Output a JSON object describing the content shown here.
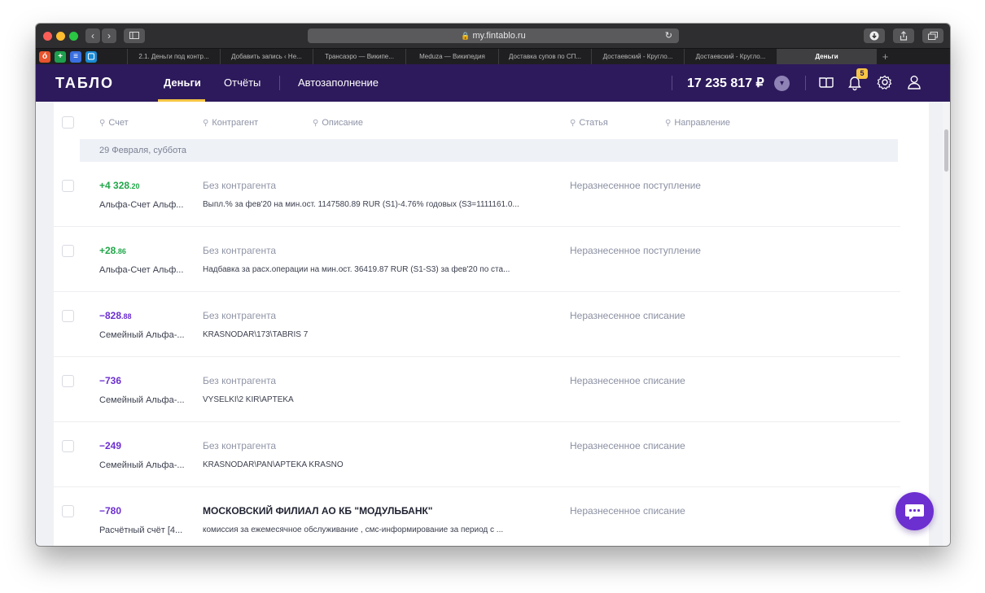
{
  "browser": {
    "url": "my.fintablo.ru",
    "tabs": [
      {
        "label": "2.1. Деньги под контр..."
      },
      {
        "label": "Добавить запись ‹ Не..."
      },
      {
        "label": "Трансаэро — Википе..."
      },
      {
        "label": "Meduza — Википедия"
      },
      {
        "label": "Доставка супов по СП..."
      },
      {
        "label": "Достаевский - Кругло..."
      },
      {
        "label": "Достаевский - Кругло..."
      },
      {
        "label": "Деньги"
      }
    ]
  },
  "header": {
    "logo": "ТАБЛО",
    "nav": [
      {
        "label": "Деньги"
      },
      {
        "label": "Отчёты"
      },
      {
        "label": "Автозаполнение"
      }
    ],
    "balance": "17 235 817 ₽",
    "notifications_count": "5"
  },
  "columns": {
    "account": "Счет",
    "counterparty": "Контрагент",
    "description": "Описание",
    "category": "Статья",
    "direction": "Направление"
  },
  "date_group": "29 Февраля, суббота",
  "transactions": [
    {
      "amount_main": "+4 328",
      "amount_cents": ".20",
      "account": "Альфа-Счет Альф...",
      "counterparty": "Без контрагента",
      "description": "Выпл.% за фев'20 на мин.ост. 1147580.89 RUR (S1)-4.76% годовых (S3=1111161.0...",
      "category": "Неразнесенное поступление"
    },
    {
      "amount_main": "+28",
      "amount_cents": ".86",
      "account": "Альфа-Счет Альф...",
      "counterparty": "Без контрагента",
      "description": "Надбавка за расх.операции на мин.ост. 36419.87 RUR (S1-S3) за фев'20 по ста...",
      "category": "Неразнесенное поступление"
    },
    {
      "amount_main": "−828",
      "amount_cents": ".88",
      "account": "Семейный Альфа-...",
      "counterparty": "Без контрагента",
      "description": "KRASNODAR\\173\\TABRIS 7",
      "category": "Неразнесенное списание"
    },
    {
      "amount_main": "−736",
      "amount_cents": "",
      "account": "Семейный Альфа-...",
      "counterparty": "Без контрагента",
      "description": "VYSELKI\\2 KIR\\APTEKA",
      "category": "Неразнесенное списание"
    },
    {
      "amount_main": "−249",
      "amount_cents": "",
      "account": "Семейный Альфа-...",
      "counterparty": "Без контрагента",
      "description": "KRASNODAR\\PAN\\APTEKA KRASNO",
      "category": "Неразнесенное списание"
    },
    {
      "amount_main": "−780",
      "amount_cents": "",
      "account": "Расчётный счёт [4...",
      "counterparty": "МОСКОВСКИЙ ФИЛИАЛ АО КБ \"МОДУЛЬБАНК\"",
      "description": "комиссия за ежемесячное обслуживание , смс-информирование за период с ...",
      "category": "Неразнесенное списание"
    }
  ]
}
